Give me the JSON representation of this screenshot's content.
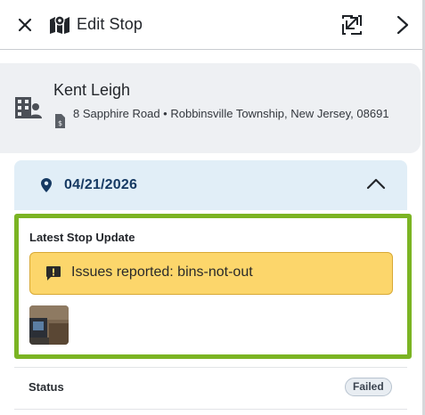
{
  "header": {
    "title": "Edit Stop",
    "close_icon": "close-icon",
    "map_icon": "map-icon",
    "expand_icon": "expand-icon",
    "next_icon": "chevron-right-icon"
  },
  "customer": {
    "name": "Kent Leigh",
    "address": "8 Sapphire Road • Robbinsville Township, New Jersey, 08691",
    "building_icon": "building-icon",
    "document_icon": "document-icon"
  },
  "visit": {
    "date": "04/21/2026",
    "pin_icon": "location-pin-icon",
    "collapse_icon": "chevron-up-icon",
    "header_color": "#e1eef7",
    "date_color": "#163a63"
  },
  "latest_update": {
    "title": "Latest Stop Update",
    "issue_text": "Issues reported: bins-not-out",
    "issue_icon": "alert-message-icon",
    "highlight_color": "#7bb423",
    "banner_color": "#fcd66b"
  },
  "status": {
    "label": "Status",
    "value": "Failed"
  }
}
